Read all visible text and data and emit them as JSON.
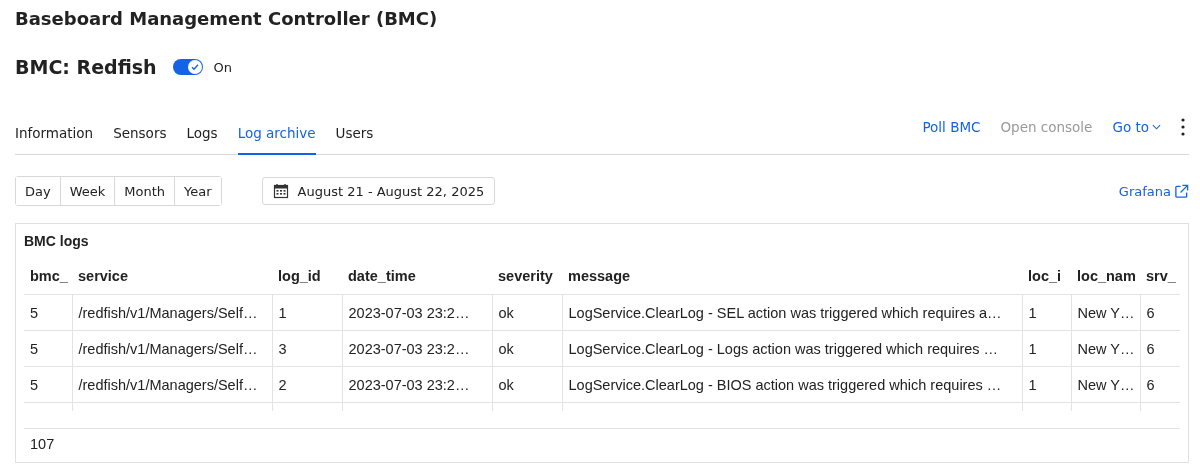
{
  "page_title": "Baseboard Management Controller (BMC)",
  "bmc": {
    "title": "BMC: Redfish",
    "toggle": {
      "on": true,
      "label": "On"
    }
  },
  "tabs": [
    {
      "label": "Information",
      "selected": false
    },
    {
      "label": "Sensors",
      "selected": false
    },
    {
      "label": "Logs",
      "selected": false
    },
    {
      "label": "Log archive",
      "selected": true
    },
    {
      "label": "Users",
      "selected": false
    }
  ],
  "actions": [
    {
      "label": "Poll BMC",
      "disabled": false,
      "kind": "link"
    },
    {
      "label": "Open console",
      "disabled": true,
      "kind": "link"
    },
    {
      "label": "Go to",
      "disabled": false,
      "kind": "dropdown"
    },
    {
      "kind": "more"
    }
  ],
  "periods": [
    {
      "label": "Day",
      "selected": false
    },
    {
      "label": "Week",
      "selected": false
    },
    {
      "label": "Month",
      "selected": false
    },
    {
      "label": "Year",
      "selected": false
    }
  ],
  "date_range": "August 21 - August 22, 2025",
  "grafana_link": "Grafana",
  "panel": {
    "title": "BMC logs",
    "columns": [
      "bmc_",
      "service",
      "log_id",
      "date_time",
      "severity",
      "message",
      "loc_i",
      "loc_nam",
      "srv_"
    ],
    "rows": [
      [
        "5",
        "/redfish/v1/Managers/Self…",
        "1",
        "2023-07-03 23:2…",
        "ok",
        "LogService.ClearLog - SEL action was triggered which requires a…",
        "1",
        "New Y…",
        "6"
      ],
      [
        "5",
        "/redfish/v1/Managers/Self…",
        "3",
        "2023-07-03 23:2…",
        "ok",
        "LogService.ClearLog - Logs action was triggered which requires …",
        "1",
        "New Y…",
        "6"
      ],
      [
        "5",
        "/redfish/v1/Managers/Self…",
        "2",
        "2023-07-03 23:2…",
        "ok",
        "LogService.ClearLog - BIOS action was triggered which requires …",
        "1",
        "New Y…",
        "6"
      ]
    ],
    "footer": "107"
  }
}
